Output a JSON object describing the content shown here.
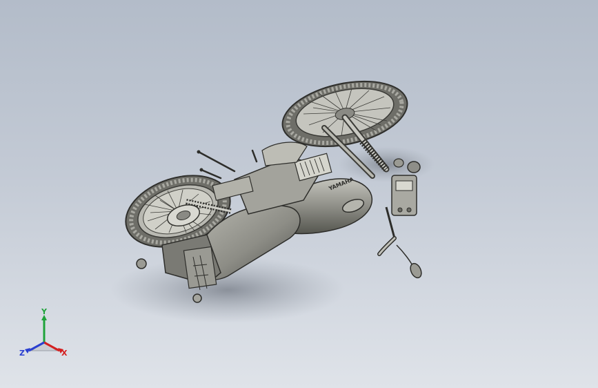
{
  "viewport": {
    "background_top": "#b3bcc9",
    "background_bottom": "#dfe3e9"
  },
  "model": {
    "body_color": "#8d8d86",
    "shadow_color": "#8a909a",
    "decal_text": "YAMAHA"
  },
  "triad": {
    "x_label": "X",
    "y_label": "Y",
    "z_label": "Z",
    "x_color": "#d42020",
    "y_color": "#1fa33a",
    "z_color": "#2a3fd0"
  }
}
